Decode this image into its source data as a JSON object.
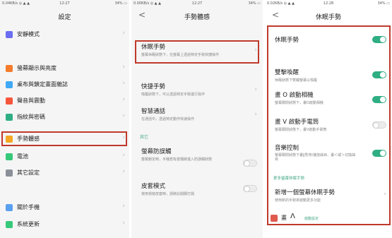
{
  "p1": {
    "status_left": "0.04KB/s ◎ ▲ ▲",
    "status_time": "12:27",
    "status_right": "34% ▭",
    "title": "設定",
    "items": [
      {
        "label": "安靜模式",
        "color": "#6b6ef0"
      },
      {
        "label": "螢幕顯示與亮度",
        "color": "#f47c2b"
      },
      {
        "label": "桌布與鎖定畫面雜誌",
        "color": "#3fa9f5"
      },
      {
        "label": "聲音與震動",
        "color": "#f5563b"
      },
      {
        "label": "指紋與密碼",
        "color": "#2fae83"
      },
      {
        "label": "手勢體感",
        "color": "#f5a623"
      },
      {
        "label": "電池",
        "color": "#37c97a"
      },
      {
        "label": "其它設定",
        "color": "#8a8f99"
      },
      {
        "label": "關於手機",
        "color": "#5aa0f0"
      },
      {
        "label": "系統更新",
        "color": "#37c97a"
      }
    ]
  },
  "p2": {
    "status_left": "0.00KB/s ◎ ▲ ▲",
    "status_time": "12:27",
    "status_right": "34% ▭",
    "title": "手勢體感",
    "back": "<",
    "items": [
      {
        "title": "休眠手勢",
        "sub": "螢幕休眠狀態下，在螢幕上透過特定手勢快捷操作"
      },
      {
        "title": "快捷手勢",
        "sub": "喚醒狀態下，可以透過特定手勢進行操作"
      },
      {
        "title": "智慧通話",
        "sub": "在通話中，透過特定動作快速操作"
      }
    ],
    "section_other": "其它",
    "items2": [
      {
        "title": "螢幕防誤觸",
        "sub": "螢幕鎖定時，手機若有遮擋將進入防誤觸狀態"
      },
      {
        "title": "皮套模式",
        "sub": "使用視窗皮套時，請將此開關打開"
      }
    ]
  },
  "p3": {
    "status_left": "0.02KB/s ◎ ▲ ▲",
    "status_time": "12:28",
    "status_right": "34% ▭",
    "title": "休眠手勢",
    "back": "<",
    "items": [
      {
        "title": "休眠手勢",
        "sub": "",
        "on": true
      },
      {
        "title": "雙擊喚醒",
        "sub": "休眠狀態下雙觸螢幕以喚醒",
        "on": true
      },
      {
        "title": "畫 O 啟動相機",
        "sub": "螢幕關閉狀態下，畫O啟動相機",
        "on": true
      },
      {
        "title": "畫 V 啟動手電筒",
        "sub": "螢幕關閉狀態下，畫V啟動手電筒",
        "on": false
      },
      {
        "title": "音樂控制",
        "sub": "螢幕關閉狀態下畫‖暫停/播放曲目、畫＜或＞切換曲目",
        "on": true
      }
    ],
    "section_more": "更多螢幕休眠手勢",
    "add_title": "新增一個螢幕休眠手勢",
    "add_sub": "使用新的手勢來啟動更多功能",
    "bottom_letter": "畫",
    "bottom_symbol": "Λ",
    "bottom_link": "啟動設定"
  }
}
